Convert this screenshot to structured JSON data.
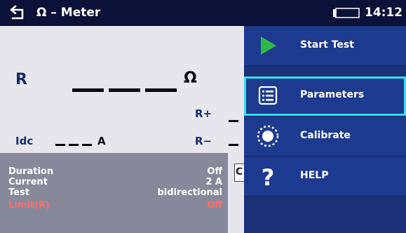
{
  "titlebar": {
    "title": "Ω – Meter",
    "clock": "14:12"
  },
  "measurement": {
    "r_label": "R",
    "r_unit": "Ω",
    "r_plus_label": "R+",
    "r_minus_label": "R−",
    "idc_label": "Idc",
    "idc_unit": "A"
  },
  "parameters": [
    {
      "label": "Duration",
      "value": "Off"
    },
    {
      "label": "Current",
      "value": "2 A"
    },
    {
      "label": "Test",
      "value": "bidirectional"
    },
    {
      "label": "Limit(R)",
      "value": "Off"
    }
  ],
  "partial_box": {
    "text": "C"
  },
  "menu": {
    "items": [
      {
        "label": "Start Test",
        "icon": "play-icon"
      },
      {
        "label": "Parameters",
        "icon": "list-icon"
      },
      {
        "label": "Calibrate",
        "icon": "calibrate-icon"
      },
      {
        "label": "HELP",
        "icon": "help-icon"
      }
    ],
    "selected_index": 1
  },
  "colors": {
    "titlebar": "#0b1137",
    "menu_bg": "#1c3177",
    "selected_border": "#2fe0f0",
    "limit_text": "#ff6b6b",
    "play_green": "#2fb84a"
  }
}
